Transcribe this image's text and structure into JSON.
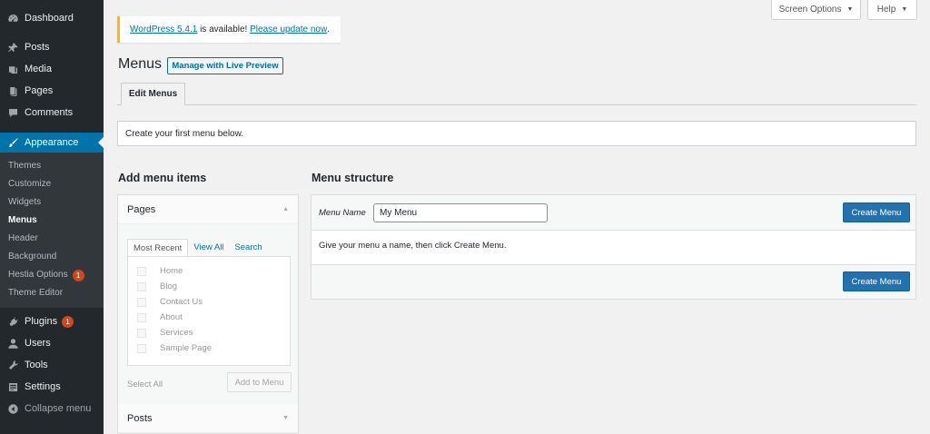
{
  "sidebar": {
    "items_top": [
      {
        "label": "Dashboard",
        "icon": "dashboard-icon"
      },
      {
        "label": "Posts",
        "icon": "pin-icon"
      },
      {
        "label": "Media",
        "icon": "media-icon"
      },
      {
        "label": "Pages",
        "icon": "pages-icon"
      },
      {
        "label": "Comments",
        "icon": "comment-icon"
      }
    ],
    "appearance": {
      "label": "Appearance",
      "icon": "brush-icon"
    },
    "submenu": [
      "Themes",
      "Customize",
      "Widgets",
      "Menus",
      "Header",
      "Background",
      "Hestia Options",
      "Theme Editor"
    ],
    "hestia_badge": "1",
    "items_bottom": [
      {
        "label": "Plugins",
        "icon": "plugin-icon",
        "badge": "1"
      },
      {
        "label": "Users",
        "icon": "users-icon"
      },
      {
        "label": "Tools",
        "icon": "wrench-icon"
      },
      {
        "label": "Settings",
        "icon": "settings-icon"
      }
    ],
    "collapse_label": "Collapse menu"
  },
  "top_tabs": {
    "screen_options": "Screen Options",
    "help": "Help"
  },
  "notice": {
    "version_link": "WordPress 5.4.1",
    "middle": " is available! ",
    "update_link": "Please update now",
    "end": "."
  },
  "header": {
    "title": "Menus",
    "live_preview": "Manage with Live Preview"
  },
  "tabs": {
    "edit_menus": "Edit Menus"
  },
  "info": "Create your first menu below.",
  "add_items": {
    "heading": "Add menu items",
    "pages_title": "Pages",
    "tabs": [
      "Most Recent",
      "View All",
      "Search"
    ],
    "pages": [
      "Home",
      "Blog",
      "Contact Us",
      "About",
      "Services",
      "Sample Page"
    ],
    "select_all": "Select All",
    "add_button": "Add to Menu",
    "posts_title": "Posts"
  },
  "structure": {
    "heading": "Menu structure",
    "name_label": "Menu Name",
    "name_value": "My Menu",
    "create_button": "Create Menu",
    "help_text": "Give your menu a name, then click Create Menu."
  },
  "colors": {
    "sidebar_bg": "#23282d",
    "accent": "#0073aa",
    "primary_button": "#2271b1",
    "badge": "#ca4a1f",
    "notice_border": "#ffb900"
  }
}
